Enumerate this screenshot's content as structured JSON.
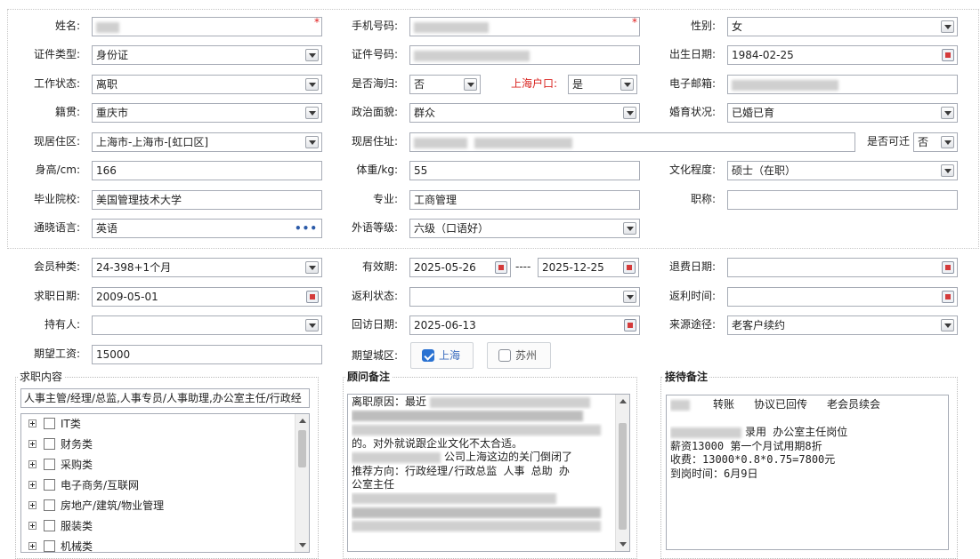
{
  "personal": {
    "name": {
      "label": "姓名:"
    },
    "phone": {
      "label": "手机号码:"
    },
    "gender": {
      "label": "性别:",
      "value": "女"
    },
    "id_type": {
      "label": "证件类型:",
      "value": "身份证"
    },
    "id_number": {
      "label": "证件号码:"
    },
    "birth_date": {
      "label": "出生日期:",
      "value": "1984-02-25"
    },
    "work_status": {
      "label": "工作状态:",
      "value": "离职"
    },
    "returnee": {
      "label": "是否海归:",
      "value": "否"
    },
    "shanghai_hukou": {
      "label": "上海户口:",
      "value": "是"
    },
    "email": {
      "label": "电子邮箱:"
    },
    "native_place": {
      "label": "籍贯:",
      "value": "重庆市"
    },
    "political": {
      "label": "政治面貌:",
      "value": "群众"
    },
    "marital": {
      "label": "婚育状况:",
      "value": "已婚已育"
    },
    "current_area": {
      "label": "现居住区:",
      "value": "上海市-上海市-[虹口区]"
    },
    "current_address": {
      "label": "现居住址:"
    },
    "relocatable": {
      "label": "是否可迁",
      "value": "否"
    },
    "height": {
      "label": "身高/cm:",
      "value": "166"
    },
    "weight": {
      "label": "体重/kg:",
      "value": "55"
    },
    "education": {
      "label": "文化程度:",
      "value": "硕士（在职）"
    },
    "school": {
      "label": "毕业院校:",
      "value": "美国管理技术大学"
    },
    "major": {
      "label": "专业:",
      "value": "工商管理"
    },
    "title": {
      "label": "职称:",
      "value": ""
    },
    "languages": {
      "label": "通晓语言:",
      "value": "英语"
    },
    "language_level": {
      "label": "外语等级:",
      "value": "六级（口语好）"
    }
  },
  "membership": {
    "member_type": {
      "label": "会员种类:",
      "value": "24-398+1个月"
    },
    "validity": {
      "label": "有效期:",
      "start": "2025-05-26",
      "sep": "----",
      "end": "2025-12-25"
    },
    "refund_date": {
      "label": "退费日期:",
      "value": ""
    },
    "job_seek_date": {
      "label": "求职日期:",
      "value": "2009-05-01"
    },
    "rebate_status": {
      "label": "返利状态:",
      "value": ""
    },
    "rebate_time": {
      "label": "返利时间:",
      "value": ""
    },
    "holder": {
      "label": "持有人:",
      "value": ""
    },
    "followup_date": {
      "label": "回访日期:",
      "value": "2025-06-13"
    },
    "source": {
      "label": "来源途径:",
      "value": "老客户续约"
    },
    "expected_salary": {
      "label": "期望工资:",
      "value": "15000"
    },
    "expected_city": {
      "label": "期望城区:",
      "options": [
        {
          "label": "上海",
          "checked": true
        },
        {
          "label": "苏州",
          "checked": false
        }
      ]
    }
  },
  "job_content": {
    "legend": "求职内容",
    "selected_text": "人事主管/经理/总监,人事专员/人事助理,办公室主任/行政经",
    "tree": [
      "IT类",
      "财务类",
      "采购类",
      "电子商务/互联网",
      "房地产/建筑/物业管理",
      "服装类",
      "机械类"
    ]
  },
  "advisor_notes": {
    "legend": "顾问备注",
    "lines": {
      "l1": "离职原因：最近",
      "l4": "的。对外就说跟企业文化不太合适。",
      "l5": "公司上海这边的关门倒闭了",
      "l6": "推荐方向：行政经理/行政总监 人事 总助  办",
      "l7": "公室主任"
    }
  },
  "reception_notes": {
    "legend": "接待备注",
    "lines": {
      "l1a": "转账",
      "l1b": "协议已回传",
      "l1c": "老会员续会",
      "l3": "录用 办公室主任岗位",
      "l4": "薪资13000   第一个月试用期8折",
      "l5": "收费：13000*0.8*0.75=7800元",
      "l6": "到岗时间：6月9日"
    }
  },
  "colors": {
    "required": "#e01a1a",
    "hukou_label": "#d9231f",
    "checked": "#2a72d2",
    "border": "#a7acb6"
  }
}
